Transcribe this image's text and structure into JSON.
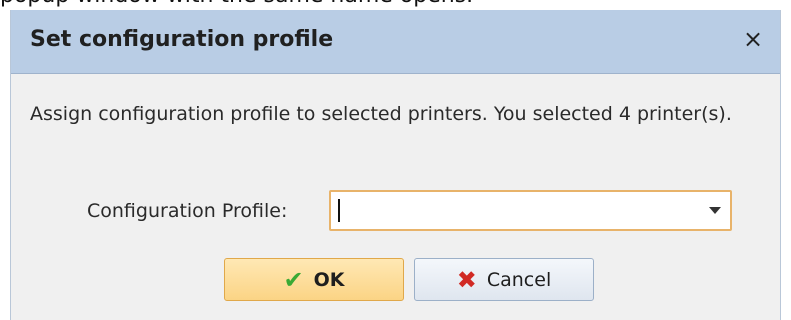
{
  "background_text": "popup window with the same name opens.",
  "dialog": {
    "title": "Set configuration profile",
    "close_label": "×",
    "message": "Assign configuration profile to selected printers. You selected 4 printer(s).",
    "field_label": "Configuration Profile:",
    "select_value": "",
    "ok_label": "OK",
    "cancel_label": "Cancel"
  },
  "icons": {
    "ok": "checkmark-icon",
    "cancel": "x-icon",
    "dropdown": "chevron-down-icon"
  },
  "colors": {
    "titlebar": "#b9cde5",
    "select_border_focus": "#e8b36a",
    "ok_button": "#fbd485",
    "check_green": "#3aaa35",
    "cancel_red": "#d12a24"
  }
}
